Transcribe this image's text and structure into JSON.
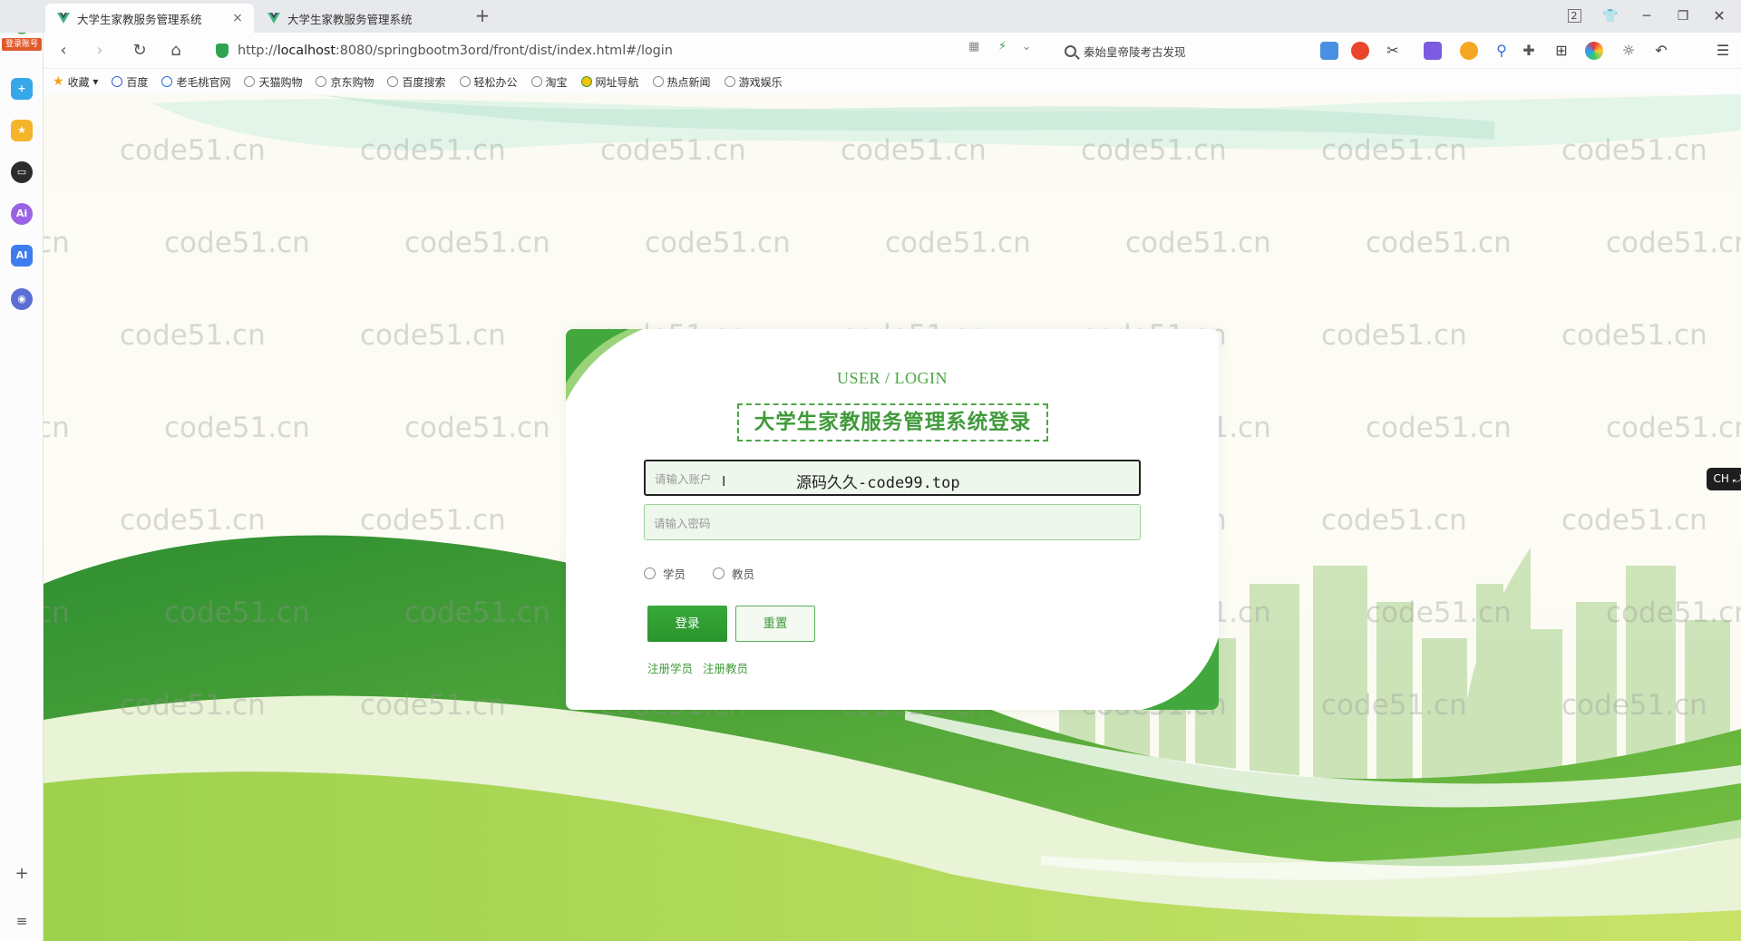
{
  "browser": {
    "tabs": [
      {
        "title": "大学生家教服务管理系统",
        "active": true
      },
      {
        "title": "大学生家教服务管理系统",
        "active": false
      }
    ],
    "new_tab_label": "+",
    "window_badge": "2",
    "url_prefix": "http://",
    "url_host": "localhost",
    "url_rest": ":8080/springbootm3ord/front/dist/index.html#/login",
    "search_placeholder": "秦始皇帝陵考古发现",
    "bookmarks": [
      "收藏",
      "百度",
      "老毛桃官网",
      "天猫购物",
      "京东购物",
      "百度搜索",
      "轻松办公",
      "淘宝",
      "网址导航",
      "热点新闻",
      "游戏娱乐"
    ],
    "sidebar_badge": "登录账号"
  },
  "login": {
    "subtitle": "USER / LOGIN",
    "title": "大学生家教服务管理系统登录",
    "account_placeholder": "请输入账户",
    "account_overlay_text": "源码久久-code99.top",
    "password_placeholder": "请输入密码",
    "roles": [
      "学员",
      "教员"
    ],
    "login_button": "登录",
    "reset_button": "重置",
    "register_links": [
      "注册学员",
      "注册教员"
    ]
  },
  "ime_indicator": "CH ⤾ 简",
  "watermark_text": "code51.cn",
  "colors": {
    "accent_green": "#3f9a3a",
    "button_green": "#2f9e31",
    "input_bg": "#eef7ec"
  }
}
